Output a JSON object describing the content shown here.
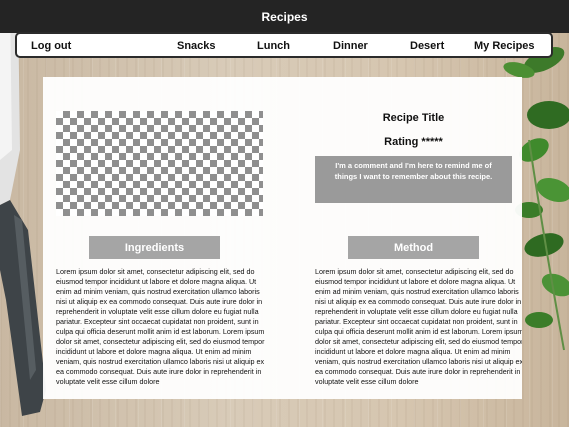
{
  "app": {
    "title": "Recipes"
  },
  "nav": {
    "logout": "Log out",
    "snacks": "Snacks",
    "lunch": "Lunch",
    "dinner": "Dinner",
    "desert": "Desert",
    "my_recipes": "My Recipes"
  },
  "recipe": {
    "title": "Recipe Title",
    "rating": "Rating *****",
    "comment": "I'm a comment and I'm here to remind me of things I want to remember about this recipe.",
    "ingredients_heading": "Ingredients",
    "method_heading": "Method",
    "ingredients_text": "Lorem ipsum dolor sit amet, consectetur adipiscing elit, sed do eiusmod tempor incididunt ut labore et dolore magna aliqua. Ut enim ad minim veniam, quis nostrud exercitation ullamco laboris nisi ut aliquip ex ea commodo consequat. Duis aute irure dolor in reprehenderit in voluptate velit esse cillum dolore eu fugiat nulla pariatur. Excepteur sint occaecat cupidatat non proident, sunt in culpa qui officia deserunt mollit anim id est laborum.  Lorem ipsum dolor sit amet, consectetur adipiscing elit, sed do eiusmod tempor incididunt ut labore et dolore magna aliqua. Ut enim ad minim veniam, quis nostrud exercitation ullamco laboris nisi ut aliquip ex ea commodo consequat. Duis aute irure dolor in reprehenderit in voluptate velit esse cillum dolore",
    "method_text": "Lorem ipsum dolor sit amet, consectetur adipiscing elit, sed do eiusmod tempor incididunt ut labore et dolore magna aliqua. Ut enim ad minim veniam, quis nostrud exercitation ullamco laboris nisi ut aliquip ex ea commodo consequat. Duis aute irure dolor in reprehenderit in voluptate velit esse cillum dolore eu fugiat nulla pariatur. Excepteur sint occaecat cupidatat non proident, sunt in culpa qui officia deserunt mollit anim id est laborum.  Lorem ipsum dolor sit amet, consectetur adipiscing elit, sed do eiusmod tempor incididunt ut labore et dolore magna aliqua. Ut enim ad minim veniam, quis nostrud exercitation ullamco laboris nisi ut aliquip ex ea commodo consequat. Duis aute irure dolor in reprehenderit in voluptate velit esse cillum dolore"
  },
  "colors": {
    "title_bar": "#242424",
    "section_header": "#a5a5a5",
    "comment_box": "#9a9a9a",
    "wood": "#d6c6b0"
  },
  "decor": {
    "left": "knife-image",
    "right": "herb-leaves-image",
    "placeholder": "image-placeholder"
  }
}
